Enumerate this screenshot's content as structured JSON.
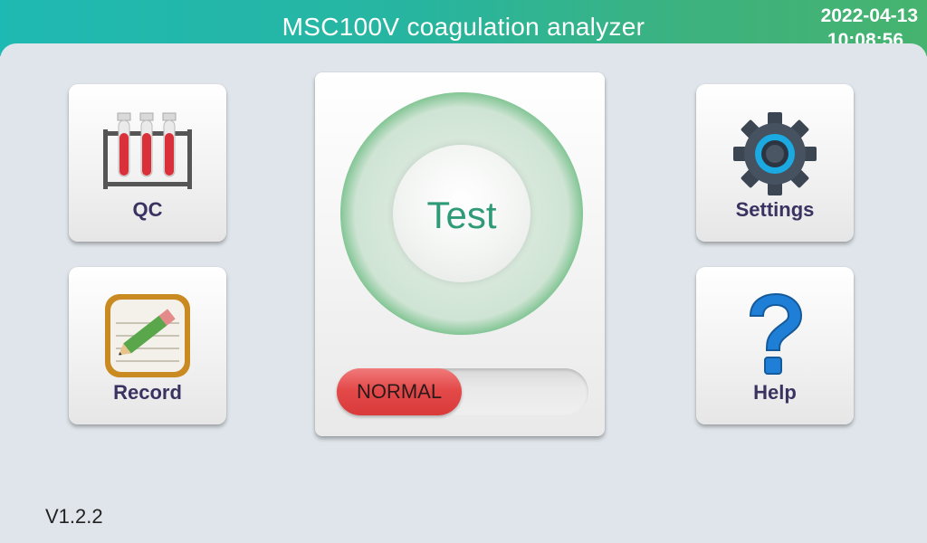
{
  "header": {
    "title": "MSC100V coagulation analyzer",
    "date": "2022-04-13",
    "time": "10:08:56"
  },
  "tiles": {
    "qc": {
      "label": "QC",
      "icon": "test-tubes-icon"
    },
    "record": {
      "label": "Record",
      "icon": "notepad-pencil-icon"
    },
    "settings": {
      "label": "Settings",
      "icon": "gear-icon"
    },
    "help": {
      "label": "Help",
      "icon": "question-mark-icon"
    }
  },
  "test": {
    "label": "Test",
    "status": "NORMAL"
  },
  "footer": {
    "version": "V1.2.2"
  },
  "colors": {
    "header_start": "#1fb9b3",
    "header_end": "#46b36f",
    "tile_label": "#3a3260",
    "test_text": "#2f9a78",
    "status_red": "#e44a4a"
  }
}
